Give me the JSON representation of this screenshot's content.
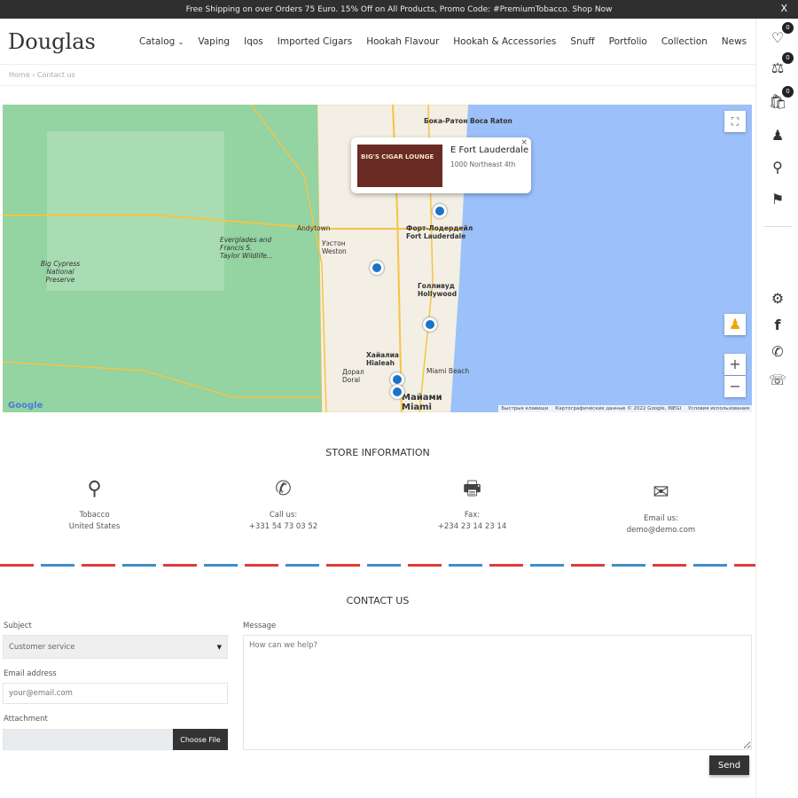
{
  "topbar": {
    "text": "Free Shipping on over Orders 75 Euro. 15% Off on All Products, Promo Code: #PremiumTobacco. Shop Now",
    "close": "X"
  },
  "header": {
    "logo": "Douglas",
    "nav": [
      "Catalog",
      "Vaping",
      "Iqos",
      "Imported Cigars",
      "Hookah Flavour",
      "Hookah & Accessories",
      "Snuff",
      "Portfolio",
      "Collection",
      "News"
    ]
  },
  "breadcrumb": {
    "home": "Home",
    "current": "Contact us"
  },
  "sidebar": {
    "wishlist_count": "0",
    "compare_count": "0",
    "cart_count": "0"
  },
  "map": {
    "popup_title": "E Fort Lauderdale",
    "popup_address": "1000 Northeast 4th",
    "popup_image_text": "BIG'S CIGAR LOUNGE",
    "labels": [
      "Бока-Ратон Boca Raton",
      "Форт-Лодердейл Fort Lauderdale",
      "Голливуд Hollywood",
      "Майами Miami",
      "Хайалиа Hialeah",
      "Everglades and Francis S. Taylor Wildlife...",
      "Big Cypress National Preserve",
      "Andytown",
      "Уэстон Weston",
      "Miami Beach",
      "Дорал Doral"
    ],
    "attribution": [
      "Быстрые клавиши",
      "Картографические данные © 2022 Google, INEGI",
      "Условия использования"
    ],
    "google": "Google"
  },
  "store": {
    "title": "STORE INFORMATION",
    "items": [
      {
        "icon": "location-pin-icon",
        "line1": "Tobacco",
        "line2": "United States"
      },
      {
        "icon": "phone-icon",
        "line1": "Call us:",
        "line2": "+331 54 73 03 52"
      },
      {
        "icon": "fax-icon",
        "line1": "Fax:",
        "line2": "+234 23 14 23 14"
      },
      {
        "icon": "envelope-icon",
        "line1": "Email us:",
        "line2": "demo@demo.com"
      }
    ]
  },
  "contact": {
    "title": "CONTACT US",
    "subject_label": "Subject",
    "subject_value": "Customer service",
    "email_label": "Email address",
    "email_placeholder": "your@email.com",
    "attachment_label": "Attachment",
    "choose_file": "Choose File",
    "message_label": "Message",
    "message_placeholder": "How can we help?",
    "send": "Send"
  },
  "colors": {
    "accent_red": "#e03b3b",
    "accent_blue": "#3e8fc9",
    "dark": "#333333"
  }
}
